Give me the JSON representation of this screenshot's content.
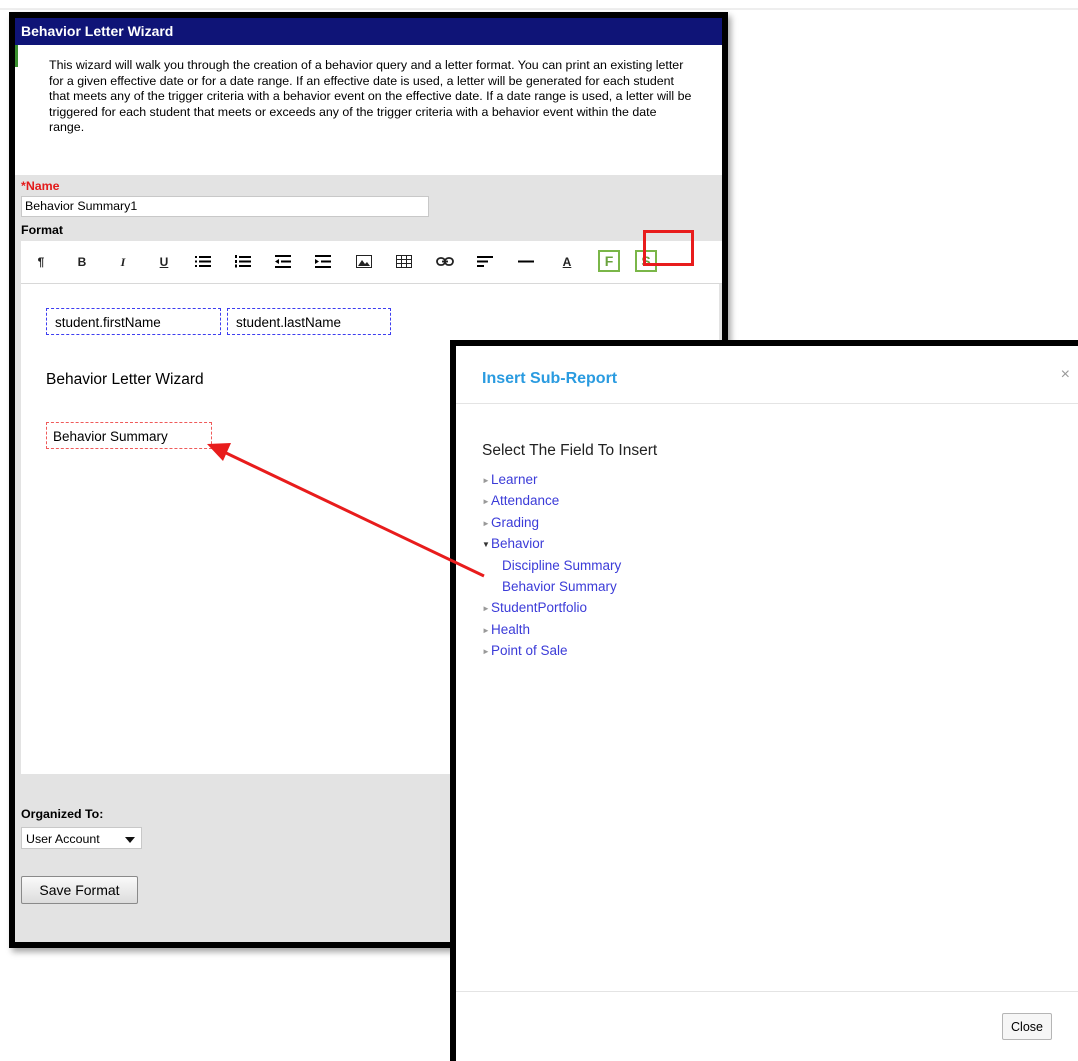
{
  "wizard": {
    "title": "Behavior Letter Wizard",
    "intro": "This wizard will walk you through the creation of a behavior query and a letter format. You can print an existing letter for a given effective date or for a date range. If an effective date is used, a letter will be generated for each student that meets any of the trigger criteria with a behavior event on the effective date. If a date range is used, a letter will be triggered for each student that meets or exceeds any of the trigger criteria with a behavior event within the date range.",
    "name_label": "*Name",
    "name_value": "Behavior Summary1",
    "format_label": "Format",
    "toolbar": {
      "paragraph": "¶",
      "bold": "B",
      "italic": "I",
      "underline": "U",
      "font_color": "A",
      "insert_field": "F",
      "insert_subreport": "S"
    },
    "editor": {
      "first_name_tag": "student.firstName",
      "last_name_tag": "student.lastName",
      "heading": "Behavior Letter Wizard",
      "subreport_tag": "Behavior Summary"
    },
    "organized_label": "Organized To:",
    "organized_value": "User Account",
    "save_button": "Save Format"
  },
  "dialog": {
    "title": "Insert Sub-Report",
    "close_x": "×",
    "heading": "Select The Field To Insert",
    "tree": {
      "learner": "Learner",
      "attendance": "Attendance",
      "grading": "Grading",
      "behavior": "Behavior",
      "discipline_summary": "Discipline Summary",
      "behavior_summary": "Behavior Summary",
      "student_portfolio": "StudentPortfolio",
      "health": "Health",
      "point_of_sale": "Point of Sale"
    },
    "close_button": "Close"
  },
  "colors": {
    "title_bar": "#0f1477",
    "highlight": "#e81c1c",
    "link": "#3b3bd8",
    "dialog_title": "#2a9be0",
    "field_tag_border": "#3d3df0",
    "subreport_tag_border": "#ef5a5a",
    "toolbar_fs_border": "#7ab648"
  },
  "icons": {
    "collapsed": "triangle-right",
    "expanded": "triangle-down"
  }
}
